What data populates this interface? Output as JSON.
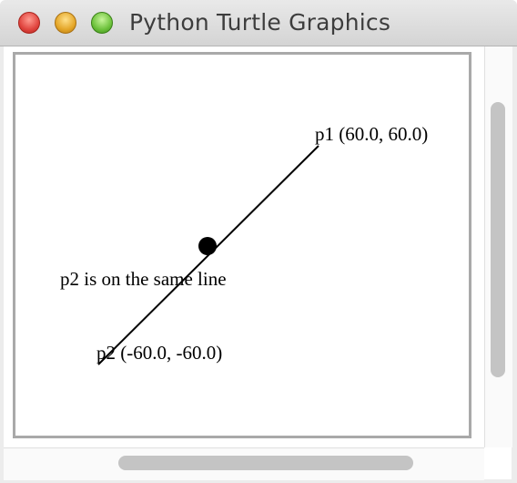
{
  "window": {
    "title": "Python Turtle Graphics"
  },
  "canvas": {
    "labels": {
      "p1": "p1 (60.0, 60.0)",
      "p2": "p2 (-60.0, -60.0)",
      "message": "p2 is on the same line"
    }
  }
}
